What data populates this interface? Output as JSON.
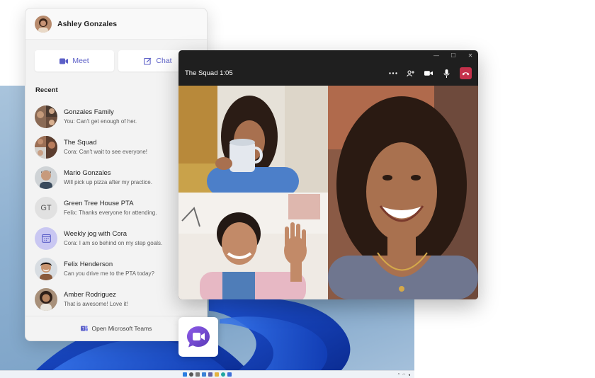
{
  "flyout": {
    "user_name": "Ashley Gonzales",
    "meet_label": "Meet",
    "chat_label": "Chat",
    "recent_label": "Recent",
    "items": [
      {
        "name": "Gonzales Family",
        "message": "You: Can't get enough of her."
      },
      {
        "name": "The Squad",
        "message": "Cora: Can't wait to see everyone!"
      },
      {
        "name": "Mario Gonzales",
        "message": "Will pick up pizza after my practice."
      },
      {
        "name": "Green Tree House PTA",
        "message": "Felix: Thanks everyone for attending.",
        "initials": "GT"
      },
      {
        "name": "Weekly jog with Cora",
        "message": "Cora: I am so behind on my step goals."
      },
      {
        "name": "Felix Henderson",
        "message": "Can you drive me to the PTA today?"
      },
      {
        "name": "Amber Rodriguez",
        "message": "That is awesome! Love it!"
      }
    ],
    "footer_label": "Open Microsoft Teams"
  },
  "call": {
    "title": "The Squad 1:05"
  },
  "colors": {
    "accent": "#5b5fc7",
    "hangup": "#c4314b",
    "call_bg": "#1f1f1f",
    "flyout_bg": "#f3f3f3"
  },
  "icons": {
    "meet": "video-camera-icon",
    "chat": "chat-compose-icon",
    "more": "more-options-icon",
    "participants": "participants-icon",
    "camera": "camera-icon",
    "mic": "microphone-icon",
    "hangup": "hang-up-icon",
    "teams": "teams-logo-icon"
  }
}
